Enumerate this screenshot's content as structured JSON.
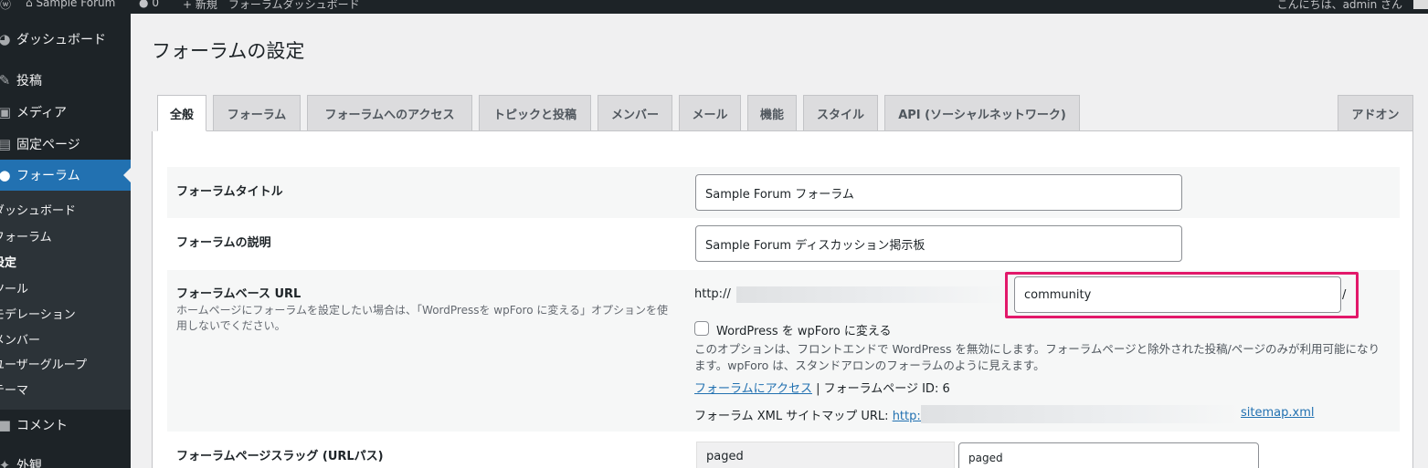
{
  "adminbar": {
    "wp_logo": "wordpress-icon",
    "site_name": "Sample Forum",
    "comments_count": "0",
    "new_label": "新規",
    "dashboard_link": "フォーラムダッシュボード",
    "greeting": "こんにちは、admin さん"
  },
  "sidebar": {
    "items": [
      {
        "label": "ダッシュボード",
        "icon": "dashboard-icon"
      },
      {
        "label": "投稿",
        "icon": "pin-icon"
      },
      {
        "label": "メディア",
        "icon": "media-icon"
      },
      {
        "label": "固定ページ",
        "icon": "page-icon"
      },
      {
        "label": "フォーラム",
        "icon": "forum-icon"
      },
      {
        "label": "コメント",
        "icon": "comment-icon"
      },
      {
        "label": "外観",
        "icon": "appearance-icon"
      }
    ],
    "submenu": [
      "ダッシュボード",
      "フォーラム",
      "設定",
      "ツール",
      "モデレーション",
      "メンバー",
      "ユーザーグループ",
      "テーマ"
    ]
  },
  "page": {
    "title": "フォーラムの設定"
  },
  "tabs": [
    "全般",
    "フォーラム",
    "フォーラムへのアクセス",
    "トピックと投稿",
    "メンバー",
    "メール",
    "機能",
    "スタイル",
    "API (ソーシャルネットワーク)",
    "アドオン"
  ],
  "settings": {
    "forum_title": {
      "label": "フォーラムタイトル",
      "value": "Sample Forum フォーラム"
    },
    "forum_description": {
      "label": "フォーラムの説明",
      "value": "Sample Forum ディスカッション掲示板"
    },
    "base_url": {
      "label": "フォーラムベース URL",
      "description": "ホームページにフォーラムを設定したい場合は、「WordPressを wpForo に変える」オプションを使用しないでください。",
      "prefix": "http://",
      "value": "community",
      "suffix": "/",
      "checkbox_label": "WordPress を wpForo に変える",
      "note": "このオプションは、フロントエンドで WordPress を無効にします。フォーラムページと除外された投稿/ページのみが利用可能になります。wpForo は、スタンドアロンのフォーラムのように見えます。",
      "access_link": "フォーラムにアクセス",
      "page_id_text": " | フォーラムページ ID: 6",
      "sitemap_label": "フォーラム XML サイトマップ URL: ",
      "sitemap_prefix": "http://",
      "sitemap_suffix": "sitemap.xml"
    },
    "page_slugs": {
      "label": "フォーラムページスラッグ (URLパス)",
      "first_slug_name": "paged",
      "first_slug_value": "paged"
    }
  }
}
